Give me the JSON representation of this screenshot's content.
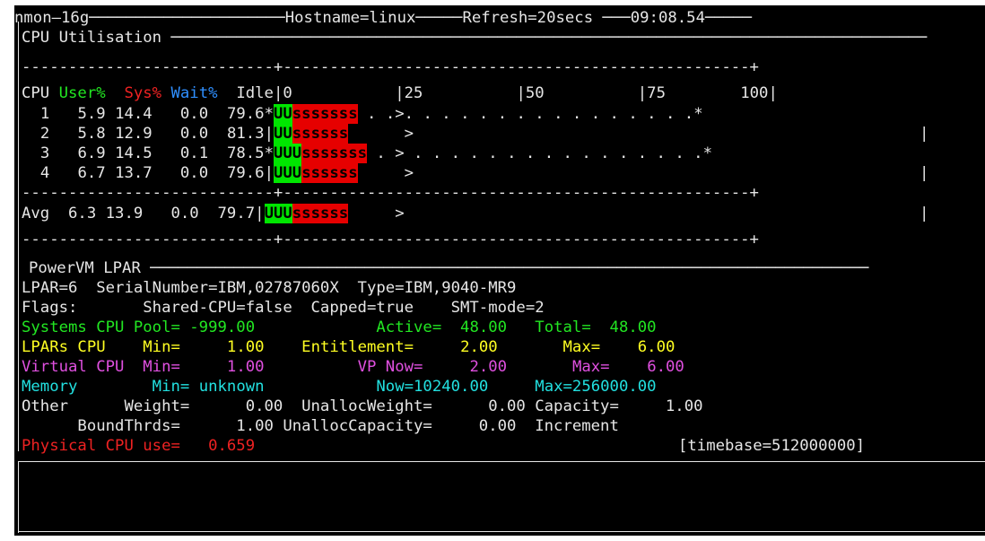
{
  "header": {
    "title": "nmon—16g",
    "hostname": "Hostname=linux",
    "refresh": "Refresh=20secs",
    "clock": "09:08.54"
  },
  "cpu_section": {
    "title": "CPU Utilisation",
    "col_cpu": "CPU",
    "col_user": "User%",
    "col_sys": "Sys%",
    "col_wait": "Wait%",
    "col_idle": "Idle",
    "scale_0": "0",
    "scale_25": "25",
    "scale_50": "50",
    "scale_75": "75",
    "scale_100": "100",
    "rows": [
      {
        "cpu": "1",
        "user": "5.9",
        "sys": "14.4",
        "wait": "0.0",
        "idle": "79.6",
        "sep": "*",
        "bar_u": "UU",
        "bar_s": "sssssss",
        "trail": " . .>. . . . . . . . . . . . . . . .",
        "end": "*"
      },
      {
        "cpu": "2",
        "user": "5.8",
        "sys": "12.9",
        "wait": "0.0",
        "idle": "81.3",
        "sep": "|",
        "bar_u": "UU",
        "bar_s": "ssssss",
        "trail": "      >",
        "end": "|"
      },
      {
        "cpu": "3",
        "user": "6.9",
        "sys": "14.5",
        "wait": "0.1",
        "idle": "78.5",
        "sep": "*",
        "bar_u": "UUU",
        "bar_s": "sssssss",
        "trail": " . > . . . . . . . . . . . . . . . .",
        "end": "*"
      },
      {
        "cpu": "4",
        "user": "6.7",
        "sys": "13.7",
        "wait": "0.0",
        "idle": "79.6",
        "sep": "|",
        "bar_u": "UUU",
        "bar_s": "ssssss",
        "trail": "     >",
        "end": "|"
      }
    ],
    "avg": {
      "label": "Avg",
      "user": "6.3",
      "sys": "13.9",
      "wait": "0.0",
      "idle": "79.7",
      "sep": "|",
      "bar_u": "UUU",
      "bar_s": "ssssss",
      "trail": "     >",
      "end": "|"
    }
  },
  "lpar_section": {
    "title": "PowerVM LPAR",
    "line1": "LPAR=6  SerialNumber=IBM,02787060X  Type=IBM,9040-MR9",
    "line2": "Flags:       Shared-CPU=false  Capped=true    SMT-mode=2",
    "sys_pool": {
      "label": "Systems CPU Pool=",
      "value": "-999.00",
      "active_label": "Active=",
      "active": "48.00",
      "total_label": "Total=",
      "total": "48.00"
    },
    "lpars_cpu": {
      "label": "LPARs CPU",
      "min_label": "Min=",
      "min": "1.00",
      "ent_label": "Entitlement=",
      "ent": "2.00",
      "max_label": "Max=",
      "max": "6.00"
    },
    "virtual_cpu": {
      "label": "Virtual CPU",
      "min_label": "Min=",
      "min": "1.00",
      "vp_label": "VP Now=",
      "vp": "2.00",
      "max_label": "Max=",
      "max": "6.00"
    },
    "memory": {
      "label": "Memory",
      "min_label": "Min=",
      "min": "unknown",
      "now_label": "Now=",
      "now": "10240.00",
      "max_label": "Max=",
      "max": "256000.00"
    },
    "other_line": "Other      Weight=      0.00  UnallocWeight=      0.00 Capacity=     1.00",
    "bound_line": "      BoundThrds=      1.00 UnallocCapacity=     0.00  Increment",
    "physical": {
      "label": "Physical CPU use=",
      "value": "0.659"
    },
    "timebase": "[timebase=512000000]"
  },
  "colors": {
    "background": "#000000",
    "text": "#e6e6e6",
    "user": "#22e622",
    "sys": "#ee2222",
    "wait": "#2f8fff",
    "yellow": "#ffff22",
    "magenta": "#e050e0",
    "cyan": "#22e0e0",
    "bar_user": "#00e600",
    "bar_sys": "#e60000"
  }
}
